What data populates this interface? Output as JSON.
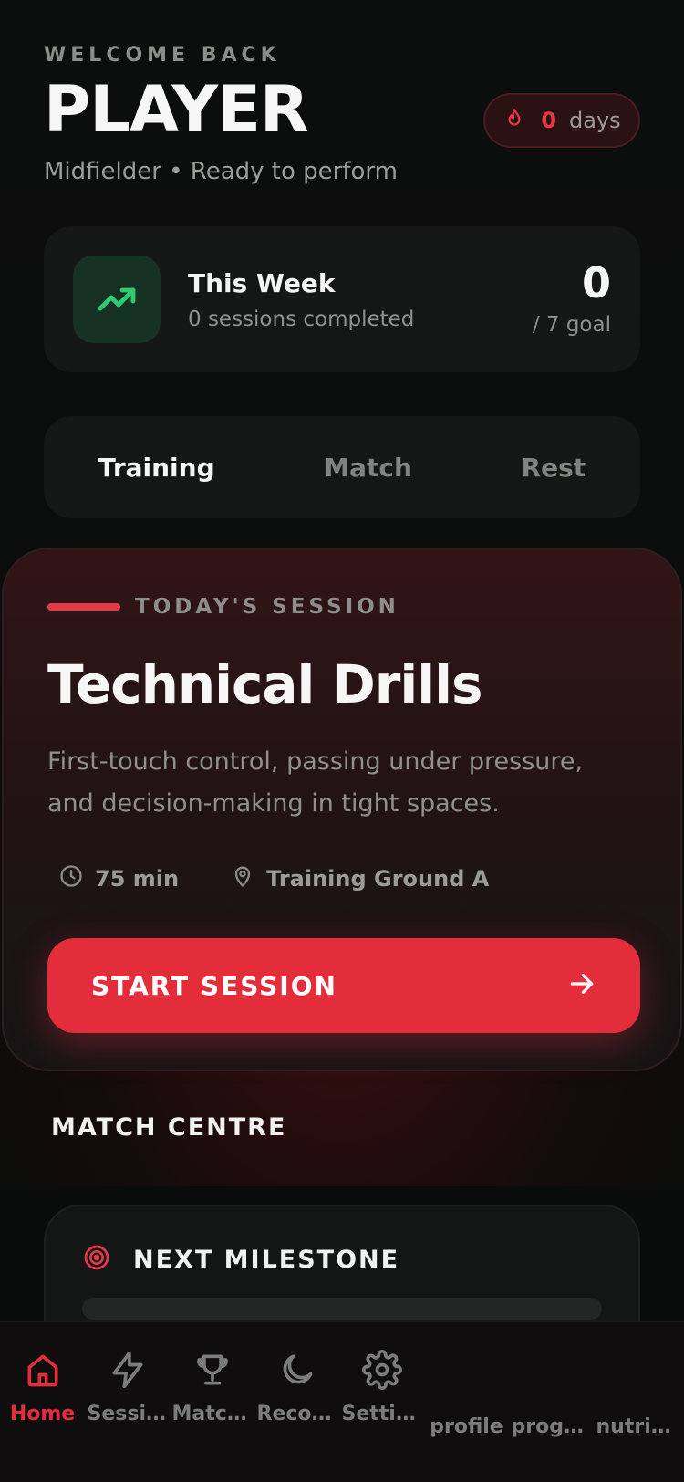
{
  "header": {
    "eyebrow": "WELCOME BACK",
    "title": "PLAYER",
    "subtitle": "Midfielder • Ready to perform",
    "streak": {
      "count": "0",
      "unit": "days",
      "icon": "flame-icon"
    }
  },
  "week": {
    "icon": "trending-up-icon",
    "title": "This Week",
    "sessions": "0 sessions completed",
    "count": "0",
    "goal": "/ 7 goal"
  },
  "tabs": [
    {
      "label": "Training",
      "active": true
    },
    {
      "label": "Match",
      "active": false
    },
    {
      "label": "Rest",
      "active": false
    }
  ],
  "session": {
    "tag": "TODAY'S SESSION",
    "title": "Technical Drills",
    "description": "First-touch control, passing under pressure, and decision-making in tight spaces.",
    "duration": "75 min",
    "location": "Training Ground A",
    "cta": "START SESSION"
  },
  "match_centre": {
    "title": "MATCH CENTRE",
    "milestone": {
      "label": "NEXT MILESTONE",
      "icon": "target-icon",
      "progress": 0
    }
  },
  "nav": [
    {
      "label": "Home",
      "icon": "home-icon",
      "active": true
    },
    {
      "label": "Sessions",
      "icon": "lightning-icon",
      "active": false
    },
    {
      "label": "Matches",
      "icon": "trophy-icon",
      "active": false
    },
    {
      "label": "Recovery",
      "icon": "moon-icon",
      "active": false
    },
    {
      "label": "Settings",
      "icon": "gear-icon",
      "active": false
    },
    {
      "label": "profile",
      "icon": "",
      "active": false
    },
    {
      "label": "progress",
      "icon": "",
      "active": false
    },
    {
      "label": "nutrition",
      "icon": "",
      "active": false
    }
  ],
  "colors": {
    "accent": "#e32d3b",
    "success": "#2ecc71",
    "background": "#0b0c0c",
    "card": "#141716"
  }
}
